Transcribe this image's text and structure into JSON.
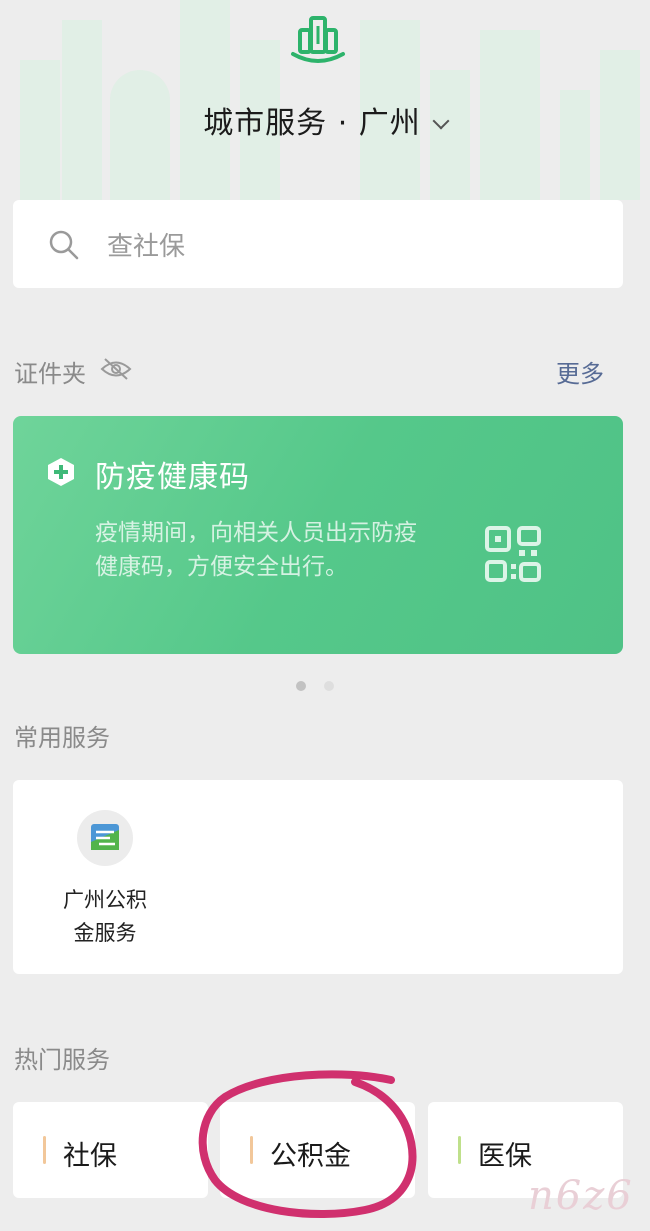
{
  "header": {
    "icon": "city-building-icon",
    "title": "城市服务 · 广州",
    "dropdown_icon": "chevron-down-icon"
  },
  "search": {
    "icon": "search-icon",
    "placeholder": "查社保"
  },
  "cards_section": {
    "label": "证件夹",
    "visibility_icon": "eye-off-icon",
    "more": "更多"
  },
  "health_card": {
    "icon": "plus-shield-icon",
    "title": "防疫健康码",
    "description": "疫情期间，向相关人员出示防疫健康码，方便安全出行。",
    "qr_icon": "qr-code-icon",
    "page_count": 2,
    "current_page": 1
  },
  "common_services": {
    "label": "常用服务",
    "items": [
      {
        "label": "广州公积金服务",
        "icon": "gz-housing-fund-icon"
      }
    ]
  },
  "hot_services": {
    "label": "热门服务",
    "items": [
      {
        "label": "社保",
        "accent": "#f2c79a"
      },
      {
        "label": "公积金",
        "accent": "#f2c79a"
      },
      {
        "label": "医保",
        "accent": "#bfe08b"
      }
    ]
  },
  "watermark": "n6z6",
  "colors": {
    "accent_green": "#4fc286",
    "link_blue": "#576b95",
    "annotation_circle": "#d0306e"
  }
}
